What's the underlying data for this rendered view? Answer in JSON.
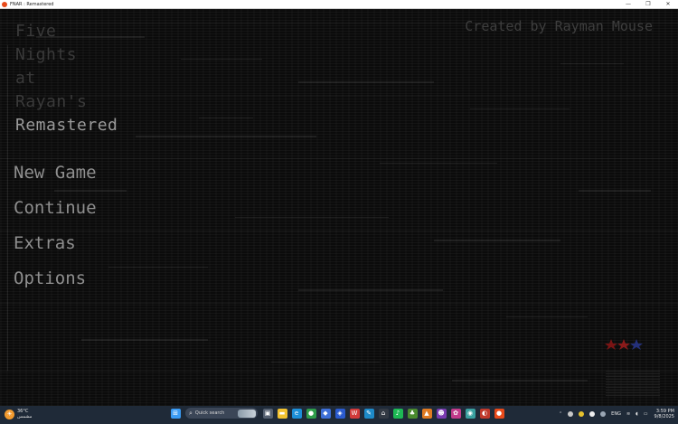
{
  "window": {
    "title": "FNAR : Remastered",
    "controls": [
      "—",
      "❐",
      "✕"
    ]
  },
  "game": {
    "title_lines": [
      "Five",
      "Nights",
      "at",
      "Rayan's",
      "Remastered"
    ],
    "credit": "Created by Rayman Mouse",
    "menu": [
      "New Game",
      "Continue",
      "Extras",
      "Options"
    ]
  },
  "taskbar": {
    "weather_temp": "36°C",
    "weather_desc": "مشمس",
    "search_placeholder": "Quick search",
    "tray_lang": "ENG",
    "clock_time": "3:59 PM",
    "clock_date": "9/8/2025",
    "colors": {
      "windows": "#3a9bf4",
      "accent": "#f29a2e"
    }
  }
}
